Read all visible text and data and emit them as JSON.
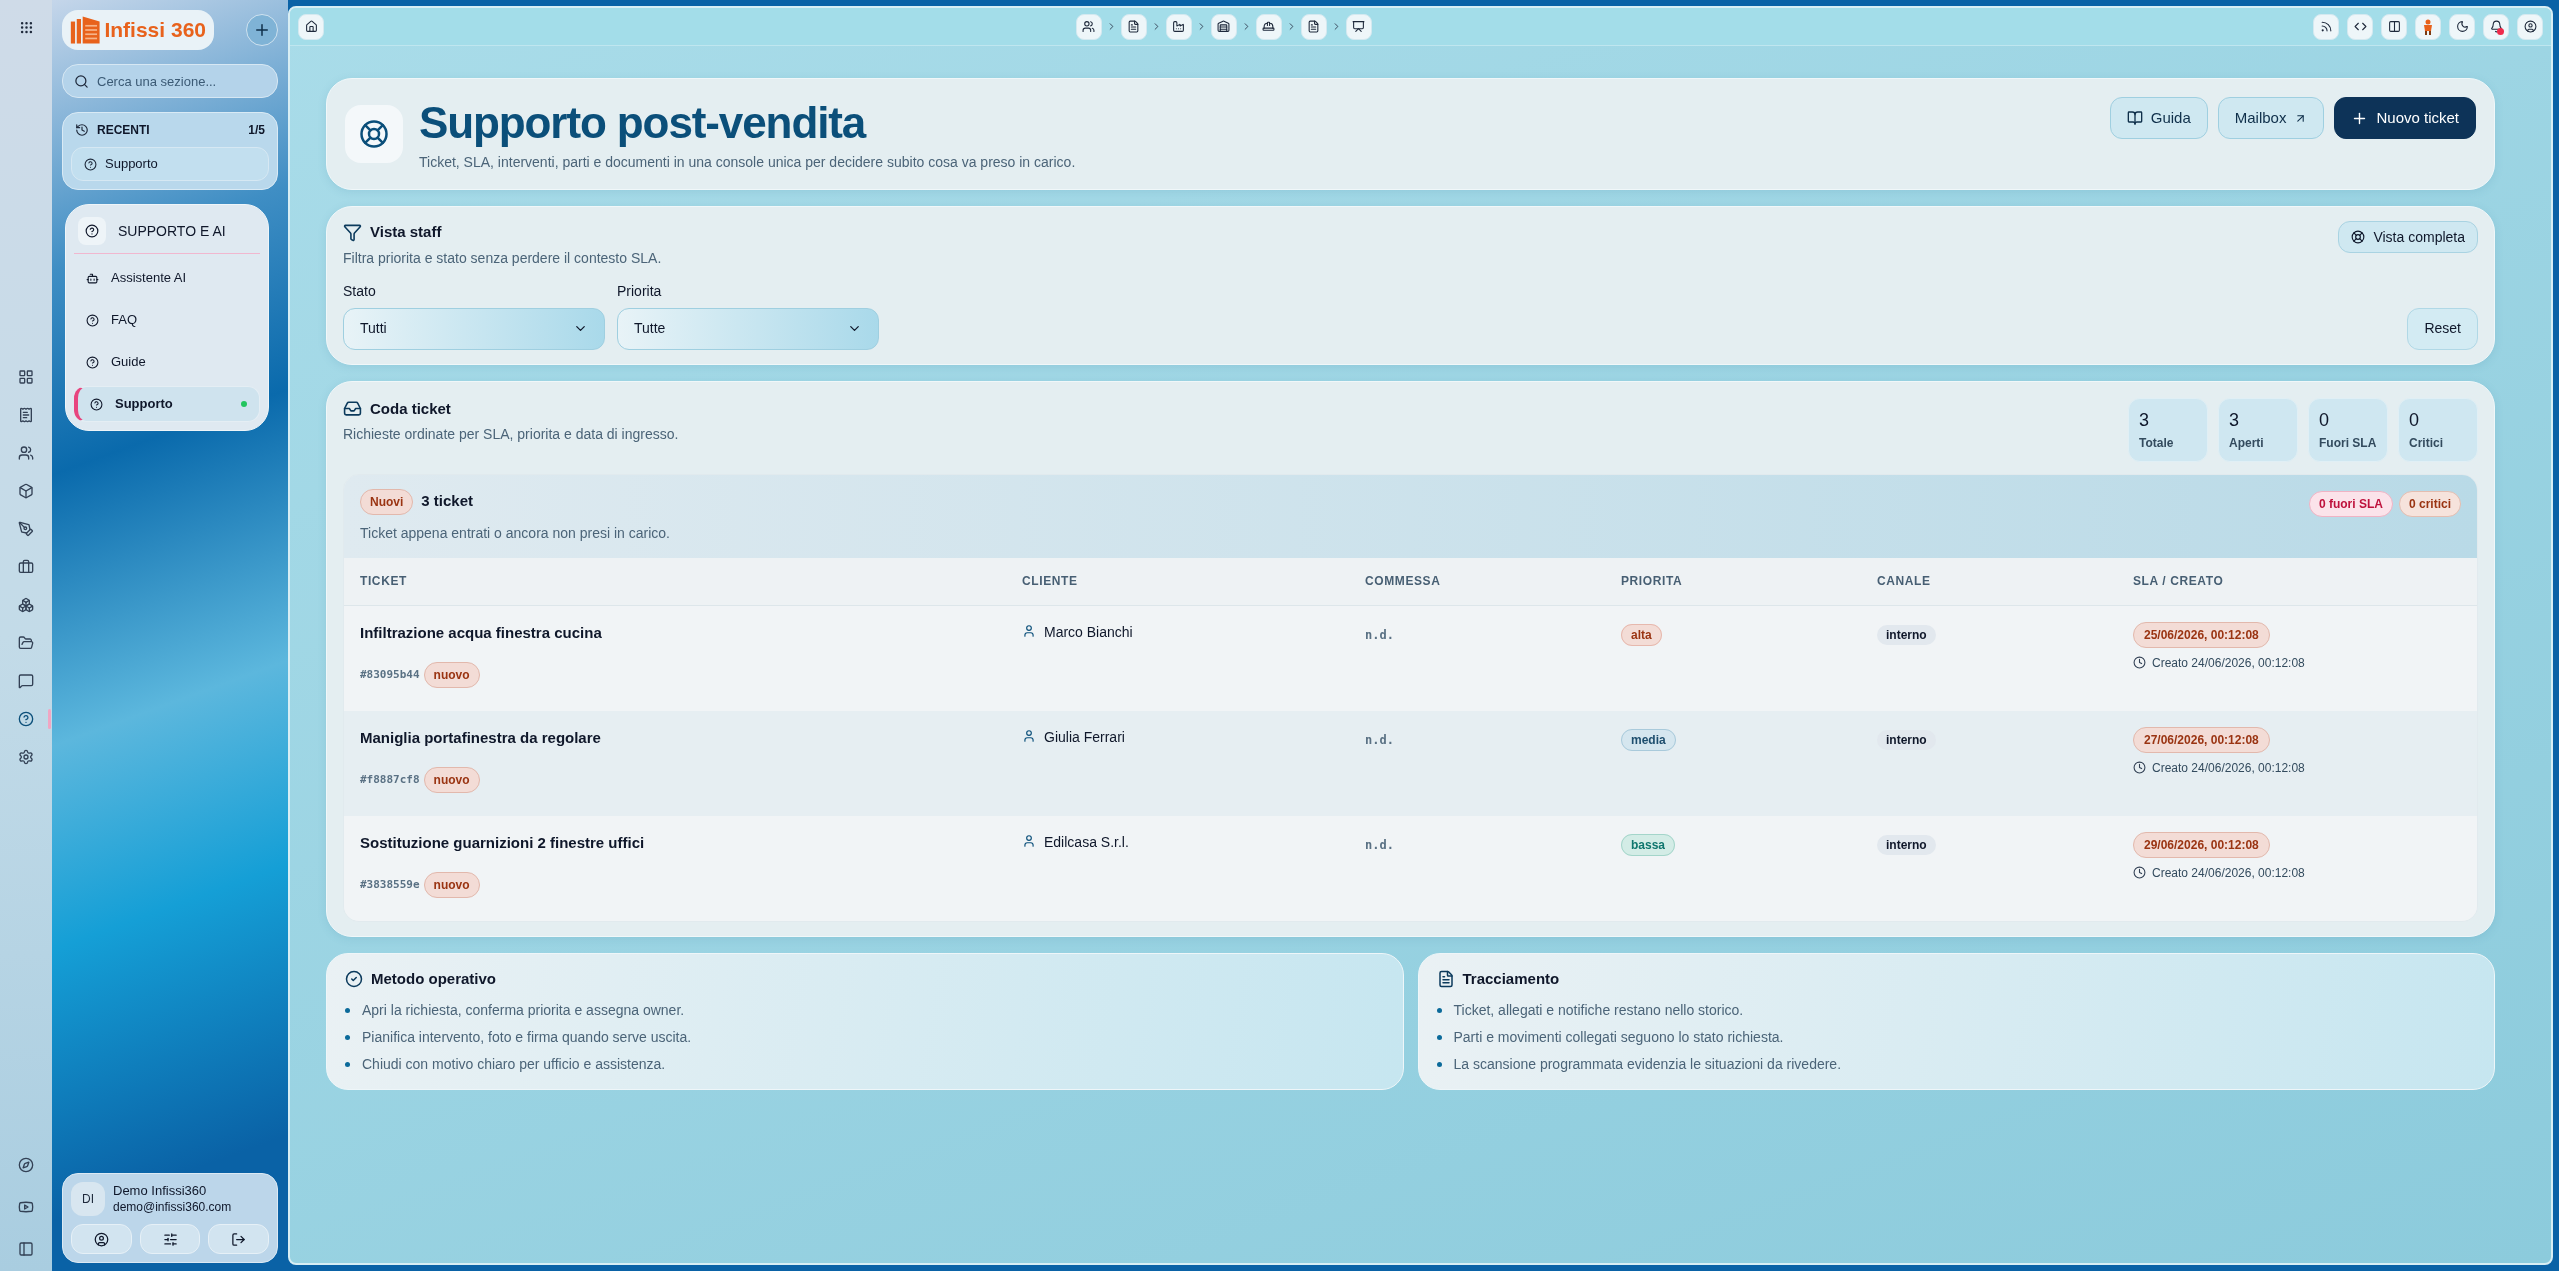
{
  "logo": {
    "text": "Infissi 360"
  },
  "search": {
    "placeholder": "Cerca una sezione..."
  },
  "recent": {
    "title": "RECENTI",
    "count": "1/5",
    "items": [
      {
        "label": "Supporto"
      }
    ]
  },
  "section": {
    "title": "SUPPORTO E AI",
    "items": [
      {
        "label": "Assistente AI",
        "kind": "bot",
        "selected": false
      },
      {
        "label": "FAQ",
        "kind": "help",
        "selected": false
      },
      {
        "label": "Guide",
        "kind": "help",
        "selected": false
      },
      {
        "label": "Supporto",
        "kind": "help",
        "selected": true
      }
    ]
  },
  "user": {
    "initials": "DI",
    "name": "Demo Infissi360",
    "email": "demo@infissi360.com"
  },
  "rail": [
    {
      "selected": false
    },
    {
      "selected": false
    },
    {
      "selected": false
    },
    {
      "selected": false
    },
    {
      "selected": false
    },
    {
      "selected": false
    },
    {
      "selected": false
    },
    {
      "selected": false
    },
    {
      "selected": false
    },
    {
      "selected": true
    },
    {
      "selected": false
    }
  ],
  "notifications": {
    "unread": true
  },
  "header": {
    "title": "Supporto post-vendita",
    "subtitle": "Ticket, SLA, interventi, parti e documenti in una console unica per decidere subito cosa va preso in carico.",
    "buttons": [
      {
        "label": "Guida",
        "kind": "guide"
      },
      {
        "label": "Mailbox",
        "kind": "external"
      },
      {
        "label": "Nuovo ticket",
        "kind": "primary"
      }
    ]
  },
  "filters": {
    "title": "Vista staff",
    "subtitle": "Filtra priorita e stato senza perdere il contesto SLA.",
    "view_button": "Vista completa",
    "fields": [
      {
        "label": "Stato",
        "value": "Tutti"
      },
      {
        "label": "Priorita",
        "value": "Tutte"
      }
    ],
    "reset": "Reset"
  },
  "queue": {
    "title": "Coda ticket",
    "subtitle": "Richieste ordinate per SLA, priorita e data di ingresso.",
    "stats": [
      {
        "value": "3",
        "label": "Totale"
      },
      {
        "value": "3",
        "label": "Aperti"
      },
      {
        "value": "0",
        "label": "Fuori SLA"
      },
      {
        "value": "0",
        "label": "Critici"
      }
    ],
    "group": {
      "badge": "Nuovi",
      "title": "3 ticket",
      "subtitle": "Ticket appena entrati o ancora non presi in carico.",
      "badges": [
        {
          "label": "0 fuori SLA",
          "kind": "sla"
        },
        {
          "label": "0 critici",
          "kind": "critical"
        }
      ]
    },
    "columns": [
      "TICKET",
      "CLIENTE",
      "COMMESSA",
      "PRIORITA",
      "CANALE",
      "SLA / CREATO"
    ],
    "rows": [
      {
        "title": "Infiltrazione acqua finestra cucina",
        "id": "#83095b44",
        "status": "nuovo",
        "client": "Marco Bianchi",
        "commessa": "n.d.",
        "priority": {
          "label": "alta",
          "kind": "high"
        },
        "channel": "interno",
        "sla": "25/06/2026, 00:12:08",
        "created": "Creato 24/06/2026, 00:12:08"
      },
      {
        "title": "Maniglia portafinestra da regolare",
        "id": "#f8887cf8",
        "status": "nuovo",
        "client": "Giulia Ferrari",
        "commessa": "n.d.",
        "priority": {
          "label": "media",
          "kind": "medium"
        },
        "channel": "interno",
        "sla": "27/06/2026, 00:12:08",
        "created": "Creato 24/06/2026, 00:12:08"
      },
      {
        "title": "Sostituzione guarnizioni 2 finestre uffici",
        "id": "#3838559e",
        "status": "nuovo",
        "client": "Edilcasa S.r.l.",
        "commessa": "n.d.",
        "priority": {
          "label": "bassa",
          "kind": "low"
        },
        "channel": "interno",
        "sla": "29/06/2026, 00:12:08",
        "created": "Creato 24/06/2026, 00:12:08"
      }
    ]
  },
  "cards": [
    {
      "title": "Metodo operativo",
      "kind": "method",
      "items": [
        "Apri la richiesta, conferma priorita e assegna owner.",
        "Pianifica intervento, foto e firma quando serve uscita.",
        "Chiudi con motivo chiaro per ufficio e assistenza."
      ]
    },
    {
      "title": "Tracciamento",
      "kind": "tracking",
      "items": [
        "Ticket, allegati e notifiche restano nello storico.",
        "Parti e movimenti collegati seguono lo stato richiesta.",
        "La scansione programmata evidenzia le situazioni da rivedere."
      ]
    }
  ]
}
